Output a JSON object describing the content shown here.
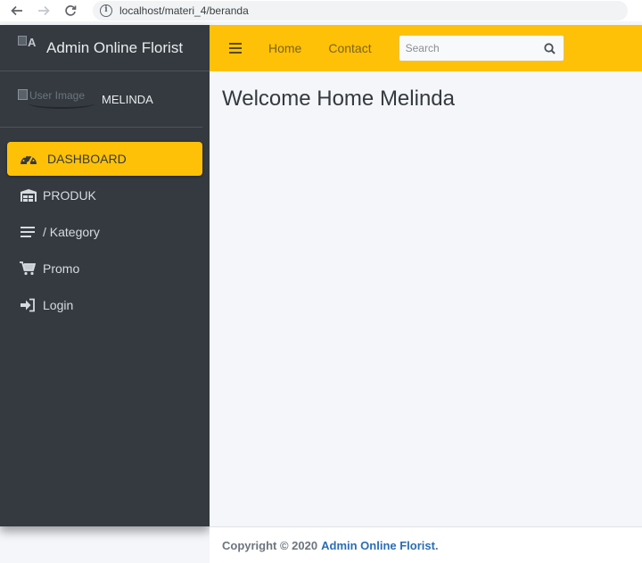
{
  "browser": {
    "url": "localhost/materi_4/beranda"
  },
  "sidebar": {
    "brand_img_alt": "A",
    "brand_text": "Admin Online Florist",
    "user_image_alt": "User Image",
    "user_name": "MELINDA",
    "items": [
      {
        "label": "DASHBOARD",
        "icon": "tachometer-icon",
        "active": true
      },
      {
        "label": "PRODUK",
        "icon": "warehouse-icon",
        "active": false
      },
      {
        "label": "/ Kategory",
        "icon": "list-icon",
        "active": false
      },
      {
        "label": "Promo",
        "icon": "cart-icon",
        "active": false
      },
      {
        "label": "Login",
        "icon": "sign-in-icon",
        "active": false
      }
    ]
  },
  "navbar": {
    "links": [
      "Home",
      "Contact"
    ],
    "search_placeholder": "Search"
  },
  "content": {
    "welcome": "Welcome Home Melinda"
  },
  "footer": {
    "copyright": "Copyright © 2020",
    "brand_link": "Admin Online Florist",
    "period": "."
  },
  "colors": {
    "accent": "#ffc107",
    "sidebar_bg": "#343a40",
    "content_bg": "#f4f6f9",
    "footer_link": "#2a6db5"
  }
}
